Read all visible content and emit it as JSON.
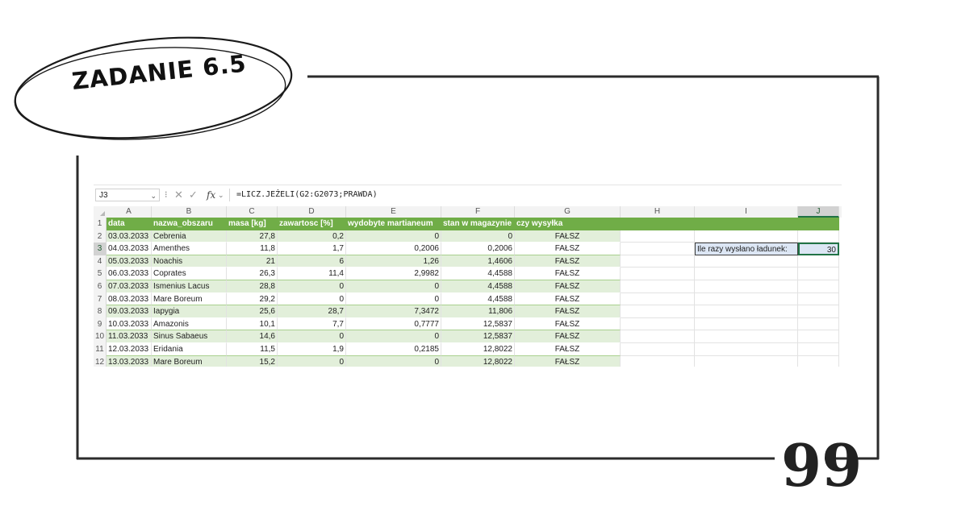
{
  "slide": {
    "title": "ZADANIE 6.5",
    "quote_mark": "99"
  },
  "excel": {
    "name_box": "J3",
    "formula": "=LICZ.JEŻELI(G2:G2073;PRAWDA)",
    "icons": {
      "cancel": "cross-icon",
      "enter": "check-icon",
      "function": "fx-icon"
    },
    "column_letters": [
      "A",
      "B",
      "C",
      "D",
      "E",
      "F",
      "G",
      "H",
      "I",
      "J"
    ],
    "selected_column": "J",
    "selected_row": "3",
    "headers": [
      "data",
      "nazwa_obszaru",
      "masa [kg]",
      "zawartosc [%]",
      "wydobyte martianeum",
      "stan w magazynie",
      "czy wysyłka"
    ],
    "rows": [
      {
        "num": "2",
        "cells": [
          "03.03.2033",
          "Cebrenia",
          "27,8",
          "0,2",
          "0",
          "0",
          "FAŁSZ"
        ]
      },
      {
        "num": "3",
        "cells": [
          "04.03.2033",
          "Amenthes",
          "11,8",
          "1,7",
          "0,2006",
          "0,2006",
          "FAŁSZ"
        ]
      },
      {
        "num": "4",
        "cells": [
          "05.03.2033",
          "Noachis",
          "21",
          "6",
          "1,26",
          "1,4606",
          "FAŁSZ"
        ]
      },
      {
        "num": "5",
        "cells": [
          "06.03.2033",
          "Coprates",
          "26,3",
          "11,4",
          "2,9982",
          "4,4588",
          "FAŁSZ"
        ]
      },
      {
        "num": "6",
        "cells": [
          "07.03.2033",
          "Ismenius Lacus",
          "28,8",
          "0",
          "0",
          "4,4588",
          "FAŁSZ"
        ]
      },
      {
        "num": "7",
        "cells": [
          "08.03.2033",
          "Mare Boreum",
          "29,2",
          "0",
          "0",
          "4,4588",
          "FAŁSZ"
        ]
      },
      {
        "num": "8",
        "cells": [
          "09.03.2033",
          "Iapygia",
          "25,6",
          "28,7",
          "7,3472",
          "11,806",
          "FAŁSZ"
        ]
      },
      {
        "num": "9",
        "cells": [
          "10.03.2033",
          "Amazonis",
          "10,1",
          "7,7",
          "0,7777",
          "12,5837",
          "FAŁSZ"
        ]
      },
      {
        "num": "10",
        "cells": [
          "11.03.2033",
          "Sinus Sabaeus",
          "14,6",
          "0",
          "0",
          "12,5837",
          "FAŁSZ"
        ]
      },
      {
        "num": "11",
        "cells": [
          "12.03.2033",
          "Eridania",
          "11,5",
          "1,9",
          "0,2185",
          "12,8022",
          "FAŁSZ"
        ]
      },
      {
        "num": "12",
        "cells": [
          "13.03.2033",
          "Mare Boreum",
          "15,2",
          "0",
          "0",
          "12,8022",
          "FAŁSZ"
        ]
      }
    ],
    "summary_label": "Ile razy wysłano ładunek:",
    "summary_value": "30",
    "colors": {
      "header_green": "#70ad47",
      "band_green": "#e2efda",
      "selection_green": "#217346",
      "summary_fill": "#dce6f4"
    }
  }
}
